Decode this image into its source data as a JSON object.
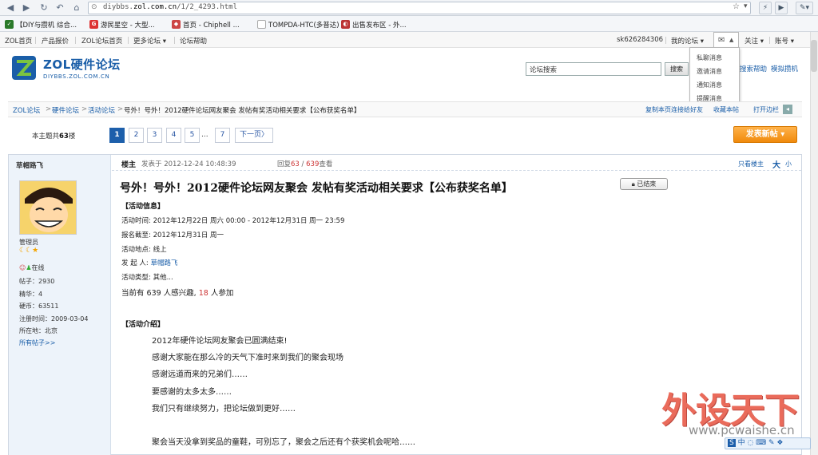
{
  "browser": {
    "url_host": "diybbs.",
    "url_domain": "zol.com.cn",
    "url_path": "/1/2_4293.html",
    "bookmarks": [
      {
        "label": "【DIY与攒机 综合..."
      },
      {
        "label": "游民星空 - 大型..."
      },
      {
        "label": "首页 - Chiphell ..."
      },
      {
        "label": "TOMPDA-HTC(多普达)"
      },
      {
        "label": "出售发布区 - 外..."
      }
    ]
  },
  "sitenav": {
    "left": [
      "ZOL首页",
      "产品报价",
      "ZOL论坛首页",
      "更多论坛 ▾",
      "论坛帮助"
    ],
    "username": "sk626284306",
    "my_forum": "我的论坛 ▾",
    "follow": "关注 ▾",
    "account": "账号 ▾"
  },
  "header": {
    "logo_title": "ZOL硬件论坛",
    "logo_sub": "DIYBBS.ZOL.COM.CN",
    "search_value": "论坛搜索",
    "search_btn": "搜索",
    "search_help": "搜索帮助",
    "mock_build": "模拟攒机"
  },
  "msg_menu": [
    "私聊消息",
    "邀请消息",
    "通知消息",
    "提醒消息"
  ],
  "breadcrumb": {
    "items": [
      "ZOL论坛",
      "硬件论坛",
      "活动论坛",
      "号外！号外！2012硬件论坛网友聚会 发帖有奖活动相关要求【公布获奖名单】"
    ],
    "copy_link": "复制本页连接给好友",
    "favorite": "收藏本帖",
    "open_sidebar": "打开边栏"
  },
  "pager": {
    "topic_count_prefix": "本主题共",
    "topic_count": "63",
    "topic_count_suffix": "楼",
    "pages": [
      "1",
      "2",
      "3",
      "4",
      "5"
    ],
    "ellipsis": "...",
    "last": "7",
    "next": "下一页〉",
    "post_new": "发表新帖 ▾"
  },
  "author": {
    "name": "草帽路飞",
    "role": "管理员",
    "status": "在线",
    "posts": "帖子：2930",
    "digest": "精华：4",
    "coins": "硬币：63511",
    "registered": "注册时间：2009-03-04",
    "location": "所在地：北京",
    "all_posts": "所有帖子>>"
  },
  "post_header": {
    "floor": "楼主",
    "posted_at": "发表于 2012-12-24 10:48:39",
    "replies_label": "回复",
    "replies": "63",
    "views": "639",
    "views_label": "查看",
    "only_author": "只看楼主",
    "font_big": "大",
    "font_small": "小"
  },
  "post": {
    "title": "号外！号外！2012硬件论坛网友聚会 发帖有奖活动相关要求【公布获奖名单】",
    "ended_badge": "已结束",
    "activity_info_heading": "【活动信息】",
    "time_label": "活动时间:",
    "time_value": "2012年12月22日 周六 00:00 - 2012年12月31日 周一 23:59",
    "deadline_label": "报名截至:",
    "deadline_value": "2012年12月31日 周一",
    "place_label": "活动地点:",
    "place_value": "线上",
    "organizer_label": "发 起 人:",
    "organizer_value": "草帽路飞",
    "type_label": "活动类型:",
    "type_value": "其他...",
    "interest_prefix": "当前有 639 人感兴趣,",
    "join_count": "18",
    "join_suffix": "人参加",
    "intro_heading": "【活动介绍】",
    "lines": [
      "2012年硬件论坛网友聚会已圆满结束!",
      "感谢大家能在那么冷的天气下准时来到我们的聚会现场",
      "感谢远道而来的兄弟们……",
      "要感谢的太多太多……",
      "我们只有继续努力，把论坛做到更好……",
      "聚会当天没拿到奖品的童鞋，可别忘了，聚会之后还有个获奖机会呢哈……"
    ]
  },
  "watermark": {
    "text": "外设天下",
    "url": "www.pcwaishe.cn",
    "ime": "中 ◌ ⌨ ✎ ❖"
  },
  "colors": {
    "link": "#1a5ea8",
    "accent_orange": "#f08a0c",
    "page_active": "#1d5fab"
  }
}
